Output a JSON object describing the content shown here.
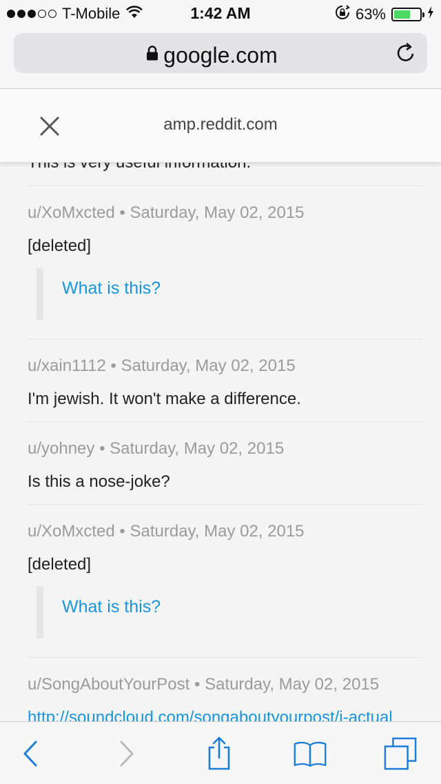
{
  "status_bar": {
    "carrier": "T-Mobile",
    "time": "1:42 AM",
    "battery_percent": "63%",
    "battery_level": 0.63,
    "signal_bars_filled": 3,
    "signal_bars_total": 5
  },
  "browser": {
    "url": "google.com"
  },
  "amp_header": {
    "domain": "amp.reddit.com"
  },
  "comments": [
    {
      "kind": "partial",
      "body": "This is very useful information."
    },
    {
      "user": "u/XoMxcted",
      "date": "Saturday, May 02, 2015",
      "body": "[deleted]",
      "quote_link": "What is this?"
    },
    {
      "user": "u/xain1112",
      "date": "Saturday, May 02, 2015",
      "body": "I'm jewish. It won't make a difference."
    },
    {
      "user": "u/yohney",
      "date": "Saturday, May 02, 2015",
      "body": "Is this a nose-joke?"
    },
    {
      "user": "u/XoMxcted",
      "date": "Saturday, May 02, 2015",
      "body": "[deleted]",
      "quote_link": "What is this?"
    },
    {
      "user": "u/SongAboutYourPost",
      "date": "Saturday, May 02, 2015",
      "link": "http://soundcloud.com/songaboutyourpost/i-actual"
    }
  ],
  "meta_separator": "•",
  "colors": {
    "link": "#1a95e0",
    "meta": "#9b9b9b",
    "battery": "#4cd964",
    "toolbar_icon": "#1a7ddb"
  },
  "icons": {
    "back": "chevron-left-icon",
    "forward": "chevron-right-icon",
    "share": "share-icon",
    "bookmarks": "book-icon",
    "tabs": "tabs-icon",
    "close": "close-icon",
    "lock": "lock-icon",
    "reload": "reload-icon"
  }
}
